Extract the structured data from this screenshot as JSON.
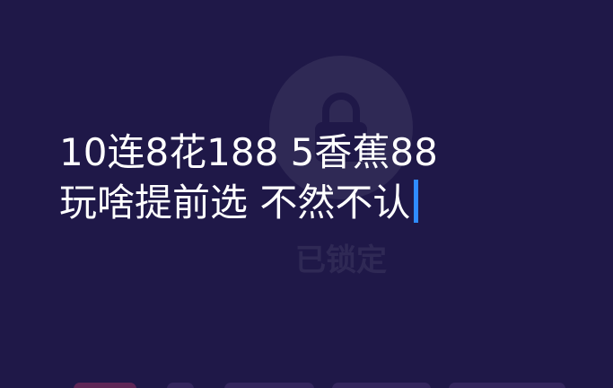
{
  "background_color": "#1f1848",
  "lock_overlay": {
    "icon": "lock-icon",
    "label": "已锁定"
  },
  "message": {
    "line1": "10连8花188 5香蕉88",
    "line2": "玩啥提前选 不然不认"
  },
  "cursor_color": "#2f8cff"
}
